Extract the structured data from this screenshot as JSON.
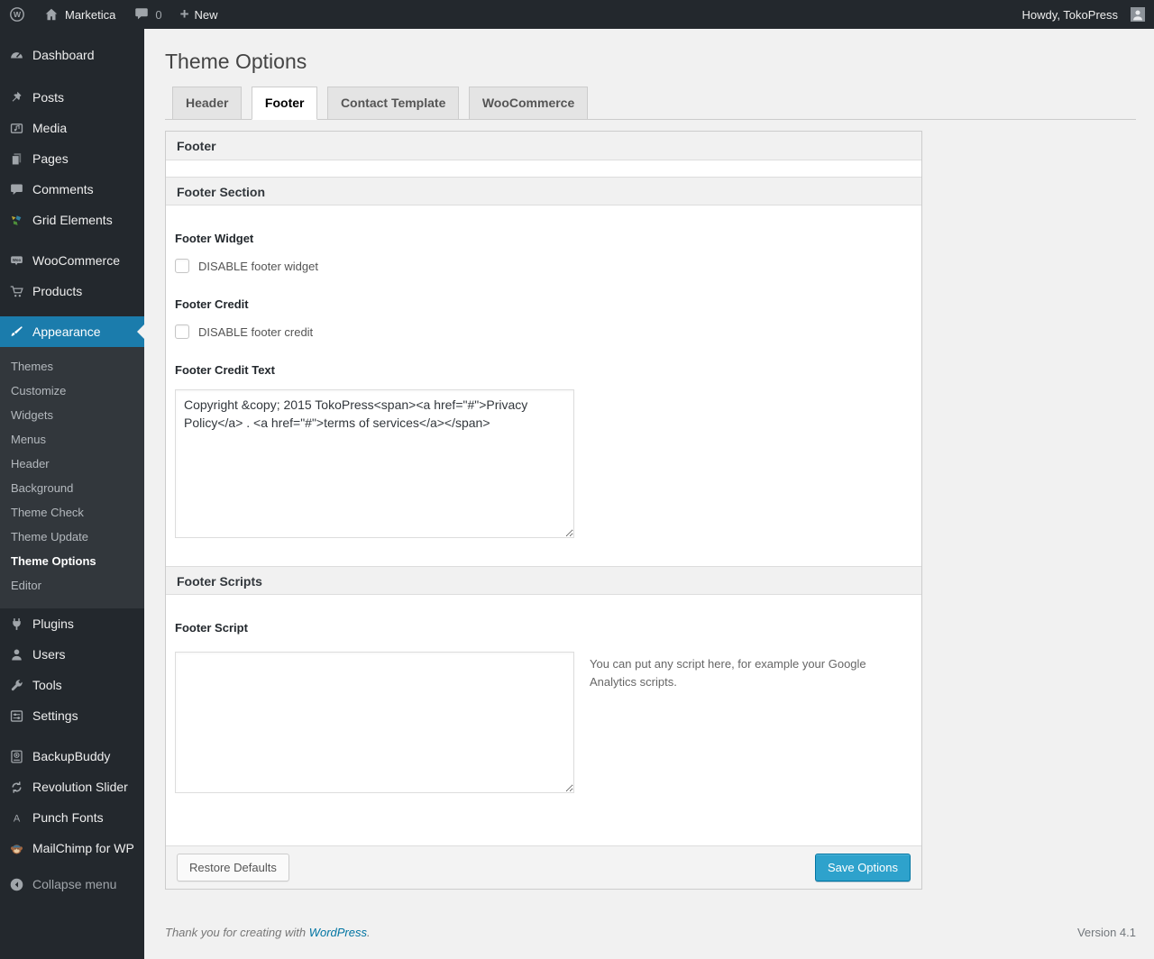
{
  "admin_bar": {
    "site_name": "Marketica",
    "comment_count": "0",
    "new_label": "New",
    "howdy": "Howdy, TokoPress"
  },
  "sidebar": {
    "items": [
      {
        "label": "Dashboard",
        "icon": "dashboard-icon"
      },
      {
        "label": "Posts",
        "icon": "pushpin-icon"
      },
      {
        "label": "Media",
        "icon": "media-icon"
      },
      {
        "label": "Pages",
        "icon": "pages-icon"
      },
      {
        "label": "Comments",
        "icon": "comments-icon"
      },
      {
        "label": "Grid Elements",
        "icon": "grid-elements-icon"
      },
      {
        "label": "WooCommerce",
        "icon": "woocommerce-icon"
      },
      {
        "label": "Products",
        "icon": "cart-icon"
      },
      {
        "label": "Appearance",
        "icon": "brush-icon"
      },
      {
        "label": "Plugins",
        "icon": "plug-icon"
      },
      {
        "label": "Users",
        "icon": "user-icon"
      },
      {
        "label": "Tools",
        "icon": "wrench-icon"
      },
      {
        "label": "Settings",
        "icon": "settings-icon"
      },
      {
        "label": "BackupBuddy",
        "icon": "backup-icon"
      },
      {
        "label": "Revolution Slider",
        "icon": "refresh-icon"
      },
      {
        "label": "Punch Fonts",
        "icon": "letter-a-icon"
      },
      {
        "label": "MailChimp for WP",
        "icon": "monkey-icon"
      }
    ],
    "submenu": [
      "Themes",
      "Customize",
      "Widgets",
      "Menus",
      "Header",
      "Background",
      "Theme Check",
      "Theme Update",
      "Theme Options",
      "Editor"
    ],
    "collapse_label": "Collapse menu"
  },
  "page": {
    "title": "Theme Options",
    "tabs": [
      {
        "label": "Header",
        "active": false
      },
      {
        "label": "Footer",
        "active": true
      },
      {
        "label": "Contact Template",
        "active": false
      },
      {
        "label": "WooCommerce",
        "active": false
      }
    ]
  },
  "panel": {
    "header": "Footer",
    "section1_title": "Footer Section",
    "footer_widget": {
      "label": "Footer Widget",
      "checkbox_label": "DISABLE footer widget",
      "checked": false
    },
    "footer_credit": {
      "label": "Footer Credit",
      "checkbox_label": "DISABLE footer credit",
      "checked": false
    },
    "footer_credit_text": {
      "label": "Footer Credit Text",
      "value": "Copyright &copy; 2015 TokoPress<span><a href=\"#\">Privacy Policy</a> . <a href=\"#\">terms of services</a></span>"
    },
    "section2_title": "Footer Scripts",
    "footer_script": {
      "label": "Footer Script",
      "value": "",
      "help": "You can put any script here, for example your Google Analytics scripts."
    },
    "actions": {
      "restore": "Restore Defaults",
      "save": "Save Options"
    }
  },
  "footer": {
    "thanks_prefix": "Thank you for creating with ",
    "wordpress_link": "WordPress",
    "thanks_suffix": ".",
    "version": "Version 4.1"
  },
  "colors": {
    "menu_highlight": "#1b7cac",
    "primary_button": "#2ea2cc",
    "link": "#0074a2"
  }
}
